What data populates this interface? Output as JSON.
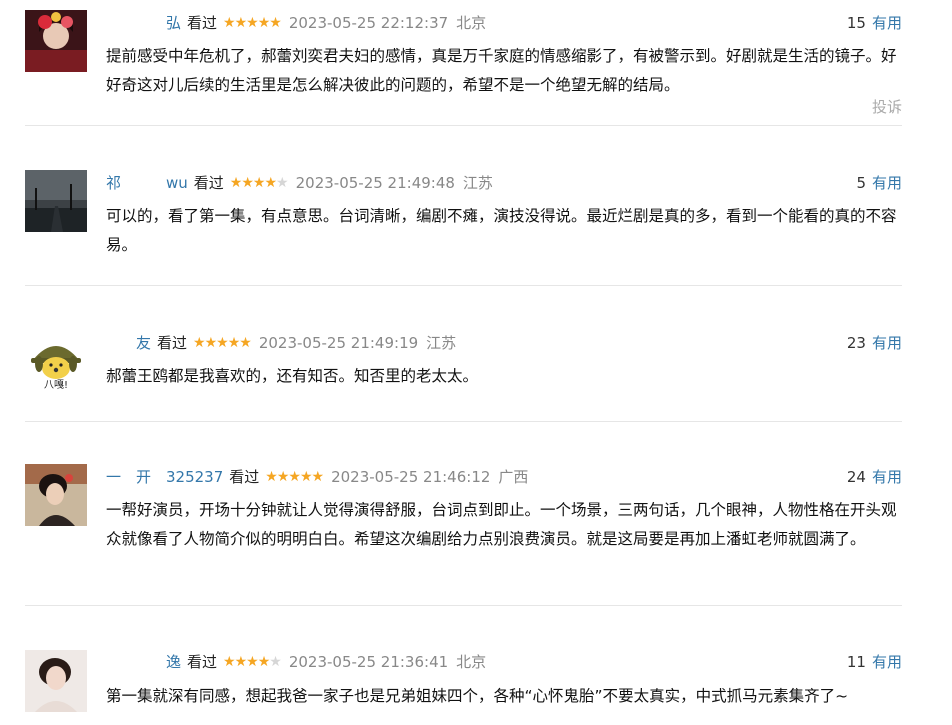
{
  "comments": [
    {
      "username": "　　　　弘",
      "watched": "看过",
      "rating": 5,
      "time": "2023-05-25 22:12:37",
      "location": "北京",
      "useful_count": "15",
      "useful_label": "有用",
      "text": "提前感受中年危机了，郝蕾刘奕君夫妇的感情，真是万千家庭的情感缩影了，有被警示到。好剧就是生活的镜子。好好奇这对儿后续的生活里是怎么解决彼此的问题的，希望不是一个绝望无解的结局。",
      "report": "投诉"
    },
    {
      "username": "祁　　　wu",
      "watched": "看过",
      "rating": 4,
      "time": "2023-05-25 21:49:48",
      "location": "江苏",
      "useful_count": "5",
      "useful_label": "有用",
      "text": "可以的，看了第一集，有点意思。台词清晰，编剧不瘫，演技没得说。最近烂剧是真的多，看到一个能看的真的不容易。"
    },
    {
      "username": "　　友",
      "watched": "看过",
      "rating": 5,
      "time": "2023-05-25 21:49:19",
      "location": "江苏",
      "useful_count": "23",
      "useful_label": "有用",
      "text": "郝蕾王鸥都是我喜欢的，还有知否。知否里的老太太。",
      "avatar_text": "八嘎!"
    },
    {
      "username": "一　开　325237",
      "watched": "看过",
      "rating": 5,
      "time": "2023-05-25 21:46:12",
      "location": "广西",
      "useful_count": "24",
      "useful_label": "有用",
      "text": "一帮好演员，开场十分钟就让人觉得演得舒服，台词点到即止。一个场景，三两句话，几个眼神，人物性格在开头观众就像看了人物简介似的明明白白。希望这次编剧给力点别浪费演员。就是这局要是再加上潘虹老师就圆满了。"
    },
    {
      "username": "　　　　逸",
      "watched": "看过",
      "rating": 4,
      "time": "2023-05-25 21:36:41",
      "location": "北京",
      "useful_count": "11",
      "useful_label": "有用",
      "text": "第一集就深有同感，想起我爸一家子也是兄弟姐妹四个，各种“心怀鬼胎”不要太真实，中式抓马元素集齐了~"
    }
  ]
}
